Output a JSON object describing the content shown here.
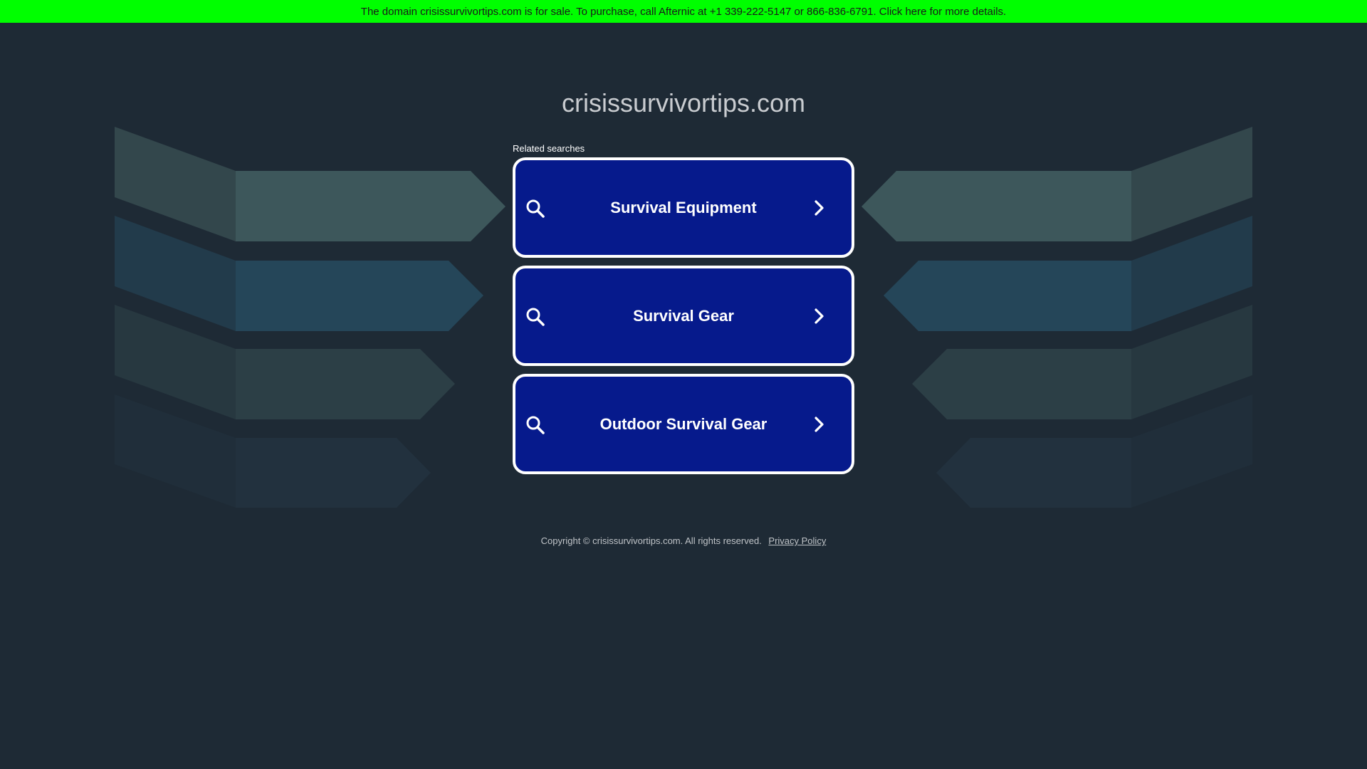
{
  "banner": {
    "text": "The domain crisissurvivortips.com is for sale. To purchase, call Afternic at +1 339-222-5147 or 866-836-6791. Click here for more details."
  },
  "site": {
    "domain": "crisissurvivortips.com"
  },
  "related": {
    "label": "Related searches",
    "items": [
      {
        "label": "Survival Equipment",
        "icon": "search-icon",
        "arrow": "chevron-right-icon"
      },
      {
        "label": "Survival Gear",
        "icon": "search-icon",
        "arrow": "chevron-right-icon"
      },
      {
        "label": "Outdoor Survival Gear",
        "icon": "search-icon",
        "arrow": "chevron-right-icon"
      }
    ]
  },
  "footer": {
    "copyright": "Copyright © crisissurvivortips.com.  All rights reserved.",
    "privacy_link": "Privacy Policy"
  },
  "colors": {
    "background": "#1e2a35",
    "banner": "#00ff00",
    "button": "#061a8c",
    "button_border": "#ffffff",
    "decor_1": "#3d575b",
    "decor_2": "#254659",
    "decor_3": "#2c3f46",
    "decor_4": "#22313e"
  }
}
